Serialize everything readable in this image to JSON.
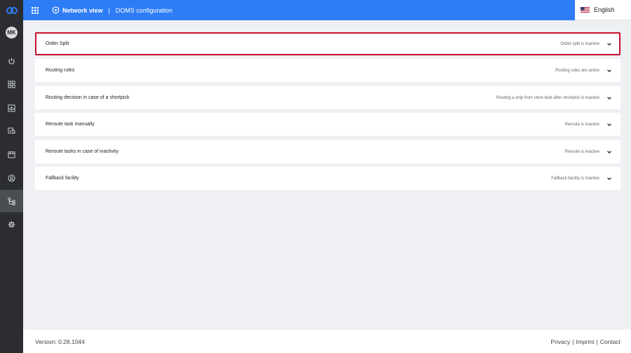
{
  "sidebar": {
    "avatar_initials": "MK",
    "items": [
      {
        "icon": "power-icon"
      },
      {
        "icon": "dashboard-icon"
      },
      {
        "icon": "inbox-icon"
      },
      {
        "icon": "shipment-icon"
      },
      {
        "icon": "store-icon"
      },
      {
        "icon": "user-circle-icon"
      },
      {
        "icon": "network-icon",
        "active": true
      },
      {
        "icon": "gear-icon"
      }
    ]
  },
  "header": {
    "title": "Network view",
    "separator": "|",
    "breadcrumb": "DOMS configuration",
    "language": "English",
    "accent_color": "#2f7df6"
  },
  "panels": [
    {
      "title": "Order Split",
      "status": "Order split is inactive",
      "selected": true
    },
    {
      "title": "Routing rules",
      "status": "Routing rules are active"
    },
    {
      "title": "Routing decision in case of a shortpick",
      "status": "Routing a ship from store task after shortpick is inactive"
    },
    {
      "title": "Reroute task manually",
      "status": "Reroute is inactive"
    },
    {
      "title": "Reroute tasks in case of inactivity",
      "status": "Reroute is inactive"
    },
    {
      "title": "Fallback facility",
      "status": "Fallback facility is inactive"
    }
  ],
  "footer": {
    "version": "Version: 0.28.1044",
    "links": [
      "Privacy",
      "Imprint",
      "Contact"
    ],
    "divider": "|"
  }
}
